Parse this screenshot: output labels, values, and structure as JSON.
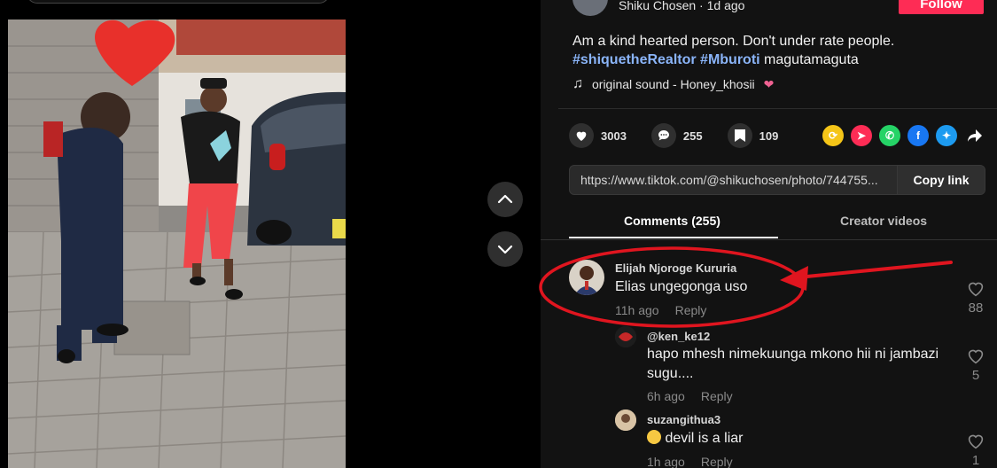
{
  "author": {
    "name": "Shiku Chosen",
    "time": "1d ago"
  },
  "follow_label": "Follow",
  "caption": {
    "line1": "Am a kind hearted person. Don't under rate people.",
    "tag1": "#shiquetheRealtor",
    "tag2": "#Mburoti",
    "tail": "magutamaguta"
  },
  "music": {
    "label": "original sound - Honey_khosii"
  },
  "stats": {
    "likes": "3003",
    "comments": "255",
    "saves": "109"
  },
  "link": {
    "url": "https://www.tiktok.com/@shikuchosen/photo/744755...",
    "copy_label": "Copy link"
  },
  "tabs": {
    "comments": "Comments (255)",
    "creator": "Creator videos"
  },
  "comments": [
    {
      "name": "Elijah Njoroge Kururia",
      "text": "Elias ungegonga uso",
      "time": "11h ago",
      "reply": "Reply",
      "likes": "88"
    },
    {
      "name": "@ken_ke12",
      "text1": "hapo mhesh nimekuunga mkono hii ni jambazi",
      "text2": "sugu....",
      "time": "6h ago",
      "reply": "Reply",
      "likes": "5"
    },
    {
      "name": "suzangithua3",
      "text": "devil is a liar",
      "time": "1h ago",
      "reply": "Reply",
      "likes": "1"
    }
  ],
  "colors": {
    "accent": "#fe2c55",
    "annotation": "#e0151f",
    "hashtag": "#8ab4f8"
  }
}
